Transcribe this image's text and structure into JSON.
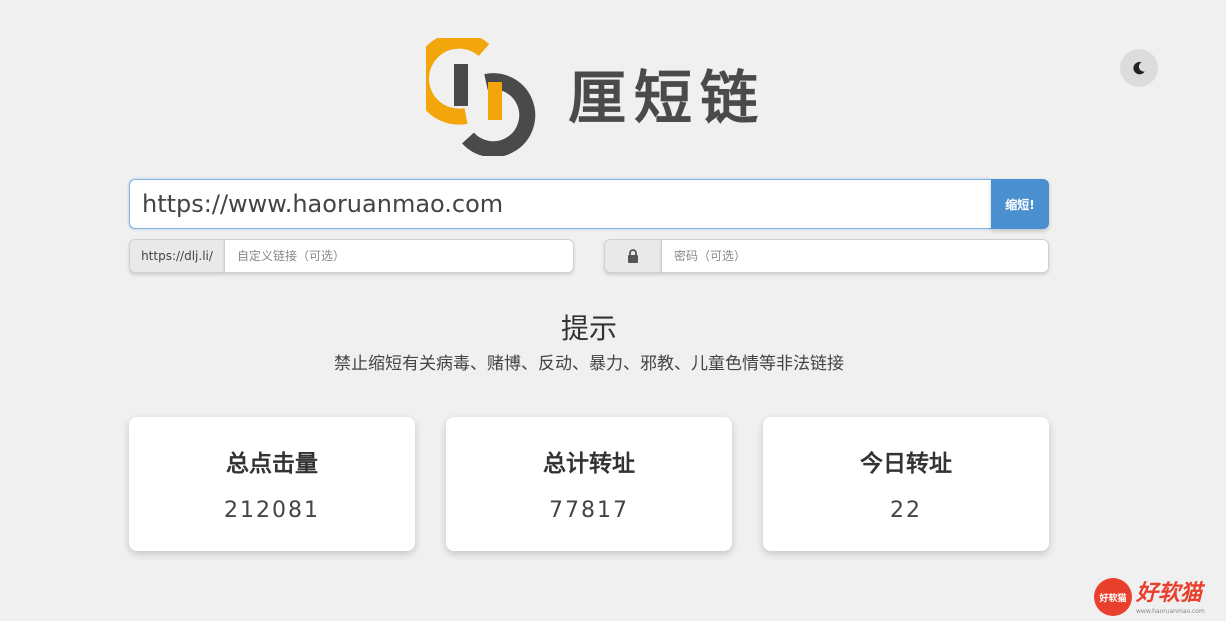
{
  "app": {
    "logo_text": "厘短链"
  },
  "url_form": {
    "url_value": "https://www.haoruanmao.com",
    "shorten_label": "缩短!",
    "domain_prefix": "https://dlj.li/",
    "custom_link_placeholder": "自定义链接（可选）",
    "password_placeholder": "密码（可选）"
  },
  "notice": {
    "title": "提示",
    "text": "禁止缩短有关病毒、赌博、反动、暴力、邪教、儿童色情等非法链接"
  },
  "stats": [
    {
      "label": "总点击量",
      "value": "212081"
    },
    {
      "label": "总计转址",
      "value": "77817"
    },
    {
      "label": "今日转址",
      "value": "22"
    }
  ],
  "watermark": {
    "badge": "好软猫",
    "text": "好软猫",
    "url": "www.haoruanmao.com"
  },
  "colors": {
    "accent": "#4a8fd0",
    "logo_orange": "#f2a60c",
    "logo_gray": "#4a4a4a",
    "background": "#f0f0f0"
  }
}
